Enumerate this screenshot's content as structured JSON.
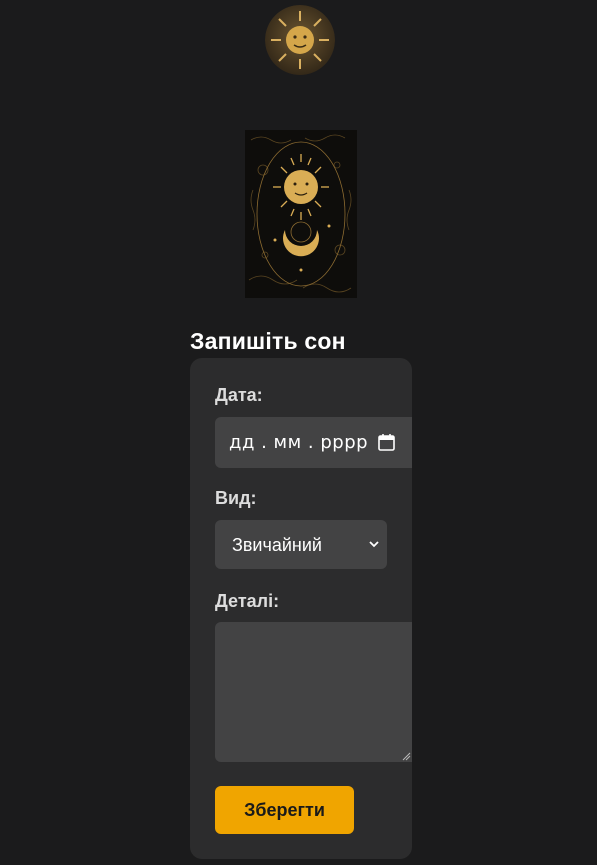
{
  "header": {
    "logo_icon": "sun-face-icon"
  },
  "hero": {
    "image_icon": "sun-moon-tarot-card-icon"
  },
  "form": {
    "title": "Запишіть сон",
    "date_label": "Дата:",
    "date_placeholder": "дд . мм . рррр",
    "calendar_icon": "calendar-icon",
    "type_label": "Вид:",
    "type_value": "Звичайний",
    "type_chevron_icon": "chevron-down-icon",
    "details_label": "Деталі:",
    "details_value": "",
    "save_label": "Зберегти"
  },
  "colors": {
    "background": "#1b1b1c",
    "card": "#2c2c2d",
    "field": "#434344",
    "accent": "#f0a500",
    "gold": "#d4a64a"
  }
}
